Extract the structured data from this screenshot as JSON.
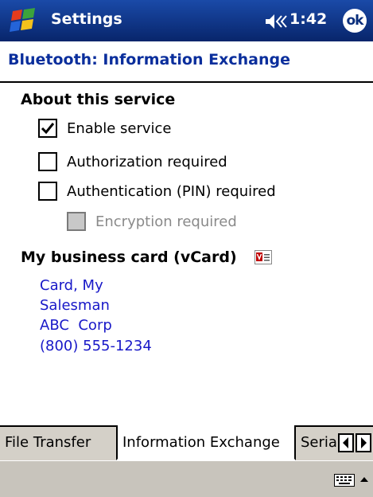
{
  "titlebar": {
    "app_title": "Settings",
    "clock": "1:42",
    "ok_label": "ok",
    "icons": [
      "windows-start-icon",
      "volume-icon"
    ]
  },
  "page": {
    "title": "Bluetooth: Information Exchange"
  },
  "about": {
    "section_title": "About this service",
    "options": [
      {
        "label": "Enable service",
        "checked": true,
        "enabled": true
      },
      {
        "label": "Authorization required",
        "checked": false,
        "enabled": true
      },
      {
        "label": "Authentication (PIN) required",
        "checked": false,
        "enabled": true
      },
      {
        "label": "Encryption required",
        "checked": false,
        "enabled": false
      }
    ]
  },
  "vcard": {
    "section_title": "My business card (vCard)",
    "icon": "vcard-icon",
    "lines": [
      "Card, My",
      "Salesman",
      "ABC  Corp",
      "(800) 555-1234"
    ]
  },
  "tabs": [
    {
      "label": "File Transfer",
      "active": false
    },
    {
      "label": "Information Exchange",
      "active": true
    },
    {
      "label": "Serial Port",
      "active": false
    }
  ],
  "menubar": {
    "icons": [
      "keyboard-icon",
      "sip-up-arrow-icon"
    ]
  },
  "colors": {
    "titlebar": "#0a2e7c",
    "heading_text": "#0a2e9c",
    "vcard_text": "#1818c8",
    "tab_strip": "#d4d0c8"
  }
}
